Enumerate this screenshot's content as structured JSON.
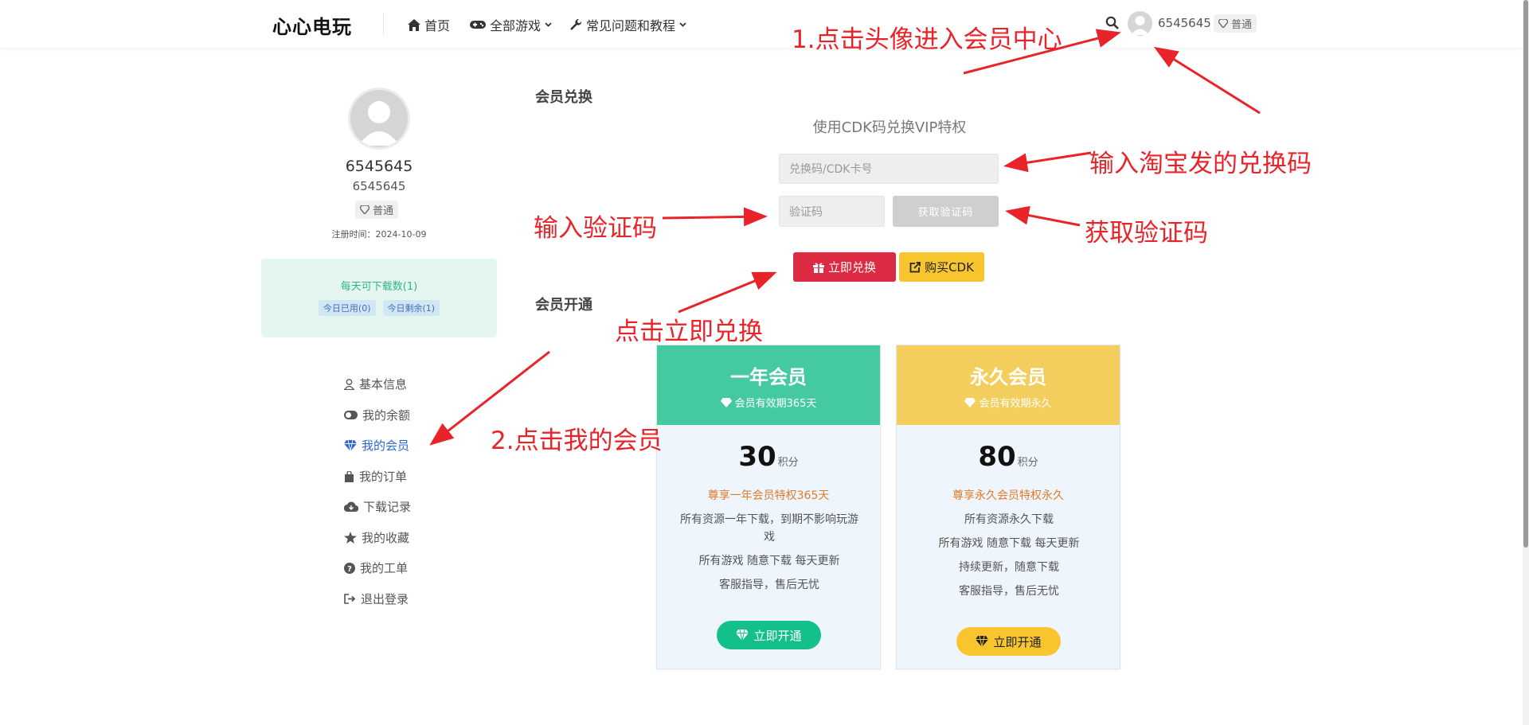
{
  "header": {
    "logo": "心心电玩",
    "nav": [
      {
        "label": "首页",
        "icon": "home-icon"
      },
      {
        "label": "全部游戏",
        "icon": "gamepad-icon"
      },
      {
        "label": "常见问题和教程",
        "icon": "wrench-icon"
      }
    ],
    "username": "6545645",
    "badge": "普通"
  },
  "profile": {
    "name": "6545645",
    "id": "6545645",
    "badge": "普通",
    "registered": "注册时间：2024-10-09",
    "download_title": "每天可下载数(1)",
    "today_used": "今日已用(0)",
    "today_left": "今日剩余(1)"
  },
  "menu": [
    {
      "label": "基本信息",
      "icon": "user-icon"
    },
    {
      "label": "我的余额",
      "icon": "toggle-icon"
    },
    {
      "label": "我的会员",
      "icon": "diamond-icon"
    },
    {
      "label": "我的订单",
      "icon": "shopping-bag-icon"
    },
    {
      "label": "下载记录",
      "icon": "cloud-download-icon"
    },
    {
      "label": "我的收藏",
      "icon": "star-icon"
    },
    {
      "label": "我的工单",
      "icon": "question-icon"
    },
    {
      "label": "退出登录",
      "icon": "sign-out-icon"
    }
  ],
  "redeem": {
    "section_title": "会员兑换",
    "subtitle": "使用CDK码兑换VIP特权",
    "cdk_placeholder": "兑换码/CDK卡号",
    "code_placeholder": "验证码",
    "get_code_btn": "获取验证码",
    "redeem_btn": "立即兑换",
    "buy_btn": "购买CDK"
  },
  "membership": {
    "section_title": "会员开通",
    "plans": [
      {
        "title": "一年会员",
        "validity": "会员有效期365天",
        "price": "30",
        "unit": "积分",
        "highlight": "尊享一年会员特权365天",
        "features": [
          "所有资源一年下载，到期不影响玩游戏",
          "所有游戏 随意下载 每天更新",
          "客服指导，售后无忧"
        ],
        "button": "立即开通",
        "color": "#45c9a0"
      },
      {
        "title": "永久会员",
        "validity": "会员有效期永久",
        "price": "80",
        "unit": "积分",
        "highlight": "尊享永久会员特权永久",
        "features": [
          "所有资源永久下载",
          "所有游戏 随意下载 每天更新",
          "持续更新，随意下载",
          "客服指导，售后无忧"
        ],
        "button": "立即开通",
        "color": "#f4ce5c"
      }
    ]
  },
  "annotations": {
    "a1": "1.点击头像进入会员中心",
    "a2": "2.点击我的会员",
    "a3": "输入淘宝发的兑换码",
    "a4": "输入验证码",
    "a5": "获取验证码",
    "a6": "点击立即兑换"
  },
  "colors": {
    "accent_red": "#dc2a43",
    "accent_yellow": "#f8c52f",
    "green": "#14c08a",
    "annotation_red": "#e8242a",
    "active_link": "#2e66d0"
  }
}
